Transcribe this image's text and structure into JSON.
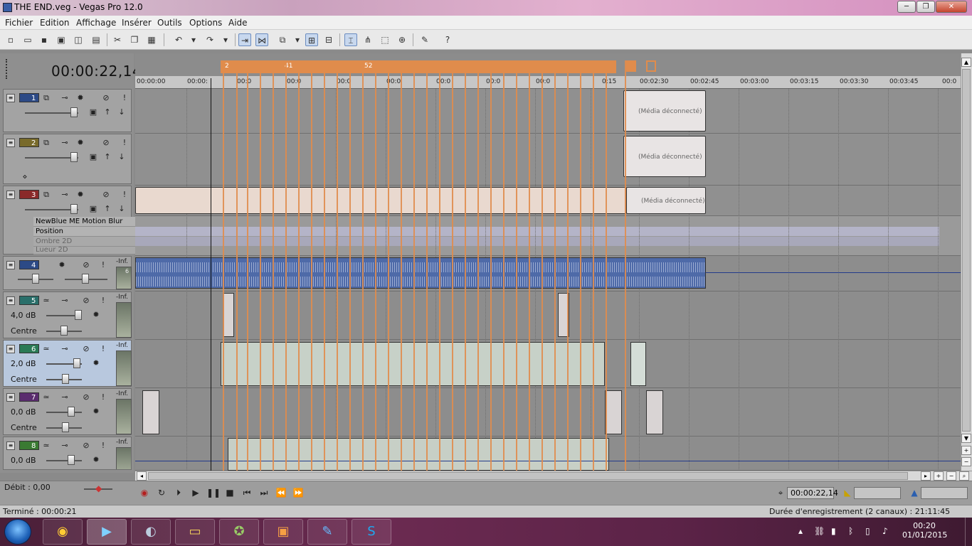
{
  "window": {
    "title": "THE END.veg - Vegas Pro 12.0",
    "min_label": "─",
    "max_label": "❐",
    "close_label": "✕"
  },
  "menu": [
    "Fichier",
    "Edition",
    "Affichage",
    "Insérer",
    "Outils",
    "Options",
    "Aide"
  ],
  "timecode": "00:00:22,14",
  "ruler": {
    "ticks": [
      "00:00:00",
      "00:00:",
      "00:0",
      "00:0",
      "00:0",
      "00:0",
      "00:0",
      "00:0",
      "00:0",
      "0:15",
      "00:02:30",
      "00:02:45",
      "00:03:00",
      "00:03:15",
      "00:03:30",
      "00:03:45",
      "00:0"
    ],
    "marker_numbers": [
      "2",
      "41",
      "52"
    ]
  },
  "tracks": [
    {
      "num": "1",
      "type": "video",
      "color": "#2c4a86"
    },
    {
      "num": "2",
      "type": "video",
      "color": "#786a2a"
    },
    {
      "num": "3",
      "type": "video",
      "color": "#8a2a2a"
    },
    {
      "num": "4",
      "type": "audio",
      "color": "#2c4a86",
      "inf": "-Inf.",
      "meter": "6"
    },
    {
      "num": "5",
      "type": "audio",
      "color": "#2a6f6a",
      "inf": "-Inf.",
      "db": "4,0 dB",
      "pan": "Centre"
    },
    {
      "num": "6",
      "type": "audio",
      "color": "#2a7a55",
      "inf": "-Inf.",
      "db": "2,0 dB",
      "pan": "Centre"
    },
    {
      "num": "7",
      "type": "audio",
      "color": "#5a2c6e",
      "inf": "-Inf.",
      "db": "0,0 dB",
      "pan": "Centre"
    },
    {
      "num": "8",
      "type": "audio",
      "color": "#3a7a32",
      "inf": "-Inf.",
      "db": "0,0 dB"
    }
  ],
  "fx_rows": [
    "NewBlue ME Motion Blur",
    "Position",
    "Ombre 2D",
    "Lueur 2D"
  ],
  "clips": {
    "media_offline": "(Média déconnecté)",
    "media_short": "Mé a"
  },
  "transport": {
    "rate_label": "Débit : 0,00",
    "position": "00:00:22,14"
  },
  "status": {
    "left": "Terminé : 00:00:21",
    "right": "Durée d'enregistrement (2 canaux) : 21:11:45"
  },
  "clock": {
    "time": "00:20",
    "date": "01/01/2015"
  },
  "colors": {
    "marker_orange": "#e08c4c",
    "audio_blue": "#4e6aa8",
    "selected_track": "#b8c8de"
  }
}
